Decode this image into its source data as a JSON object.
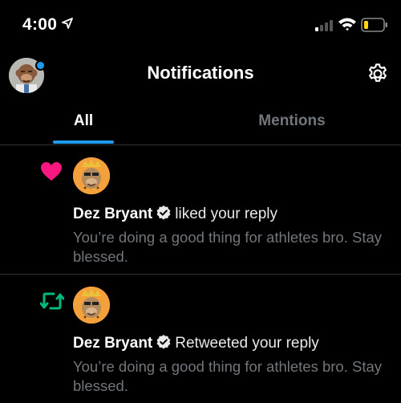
{
  "status_bar": {
    "time": "4:00",
    "icons": [
      "location-arrow-icon",
      "cellular-signal-icon",
      "wifi-icon",
      "battery-icon"
    ]
  },
  "header": {
    "title": "Notifications",
    "avatar_icon": "user-avatar",
    "settings_icon": "gear-icon"
  },
  "tabs": [
    {
      "label": "All",
      "active": true
    },
    {
      "label": "Mentions",
      "active": false
    }
  ],
  "notifications": [
    {
      "type": "like",
      "icon": "heart-icon",
      "user": "Dez Bryant",
      "verified": true,
      "action": "liked your reply",
      "text": "You’re doing a good thing for athletes bro. Stay blessed."
    },
    {
      "type": "retweet",
      "icon": "retweet-icon",
      "user": "Dez Bryant",
      "verified": true,
      "action": "Retweeted your reply",
      "text": "You’re doing a good thing for athletes bro. Stay blessed."
    }
  ],
  "colors": {
    "background": "#000000",
    "accent": "#1d9bf0",
    "like": "#f91880",
    "retweet": "#00ba7c",
    "muted_text": "#71767b",
    "divider": "#2f3336"
  }
}
